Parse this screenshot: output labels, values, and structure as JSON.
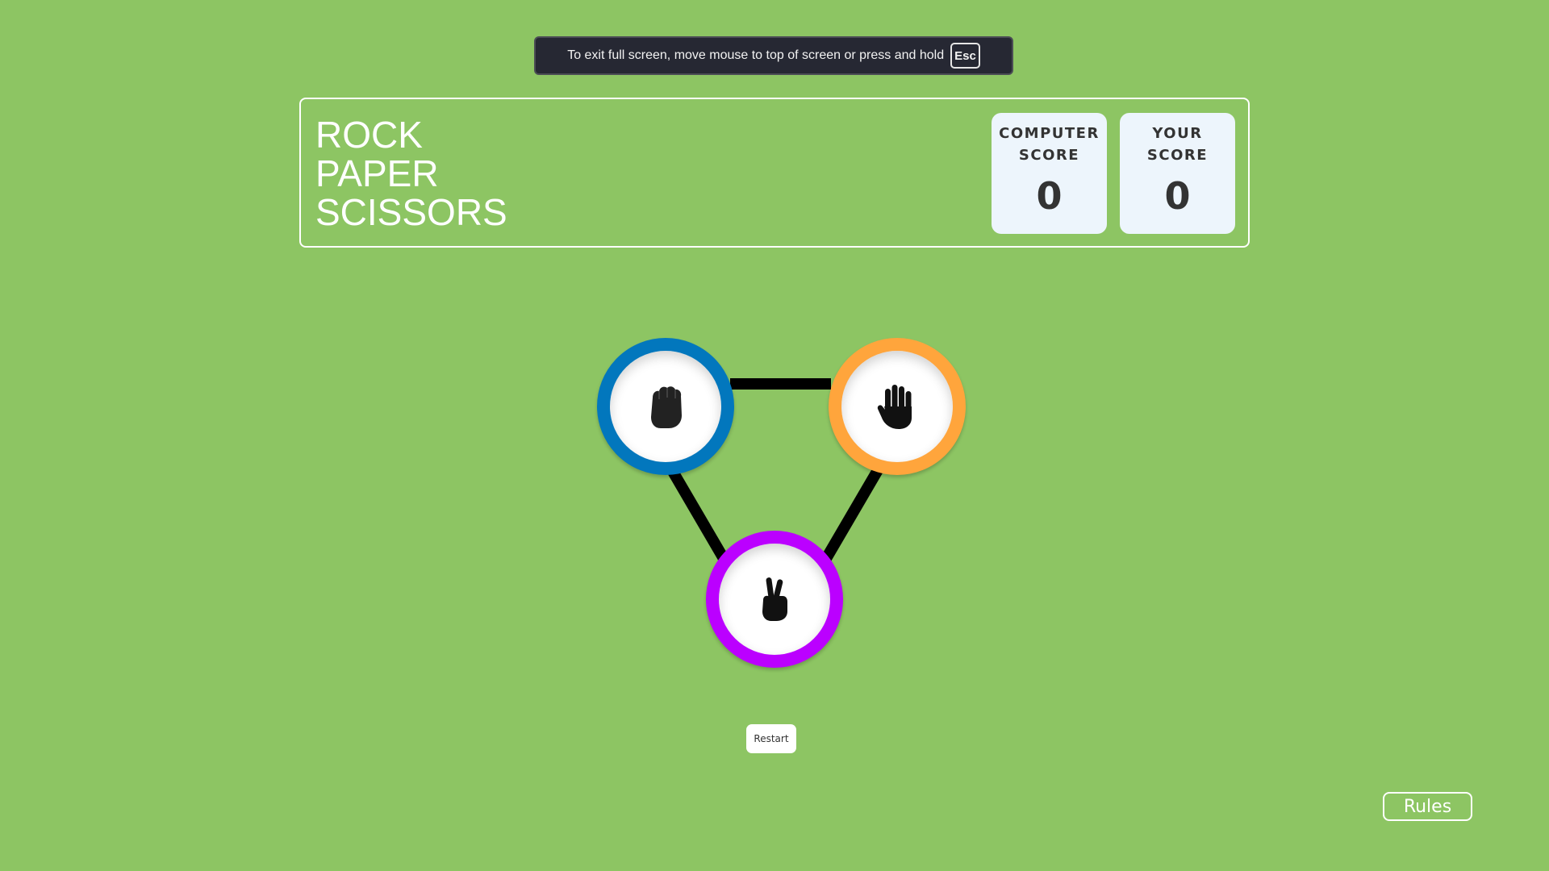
{
  "fullscreen_notice": {
    "message": "To exit full screen, move mouse to top of screen or press and hold",
    "key": "Esc"
  },
  "header": {
    "title_lines": [
      "ROCK",
      "PAPER",
      "SCISSORS"
    ],
    "computer_score": {
      "label_line1": "COMPUTER",
      "label_line2": "SCORE",
      "value": "0"
    },
    "your_score": {
      "label_line1": "YOUR",
      "label_line2": "SCORE",
      "value": "0"
    }
  },
  "choices": [
    {
      "name": "rock",
      "icon": "fist-icon",
      "ring_color": "#0277bd"
    },
    {
      "name": "paper",
      "icon": "open-hand-icon",
      "ring_color": "#ffa53c"
    },
    {
      "name": "scissors",
      "icon": "peace-hand-icon",
      "ring_color": "#bb00ff"
    }
  ],
  "buttons": {
    "restart": "Restart",
    "rules": "Rules"
  },
  "colors": {
    "background": "#8dc563",
    "card": "#edf5fc",
    "connector": "#000000"
  }
}
